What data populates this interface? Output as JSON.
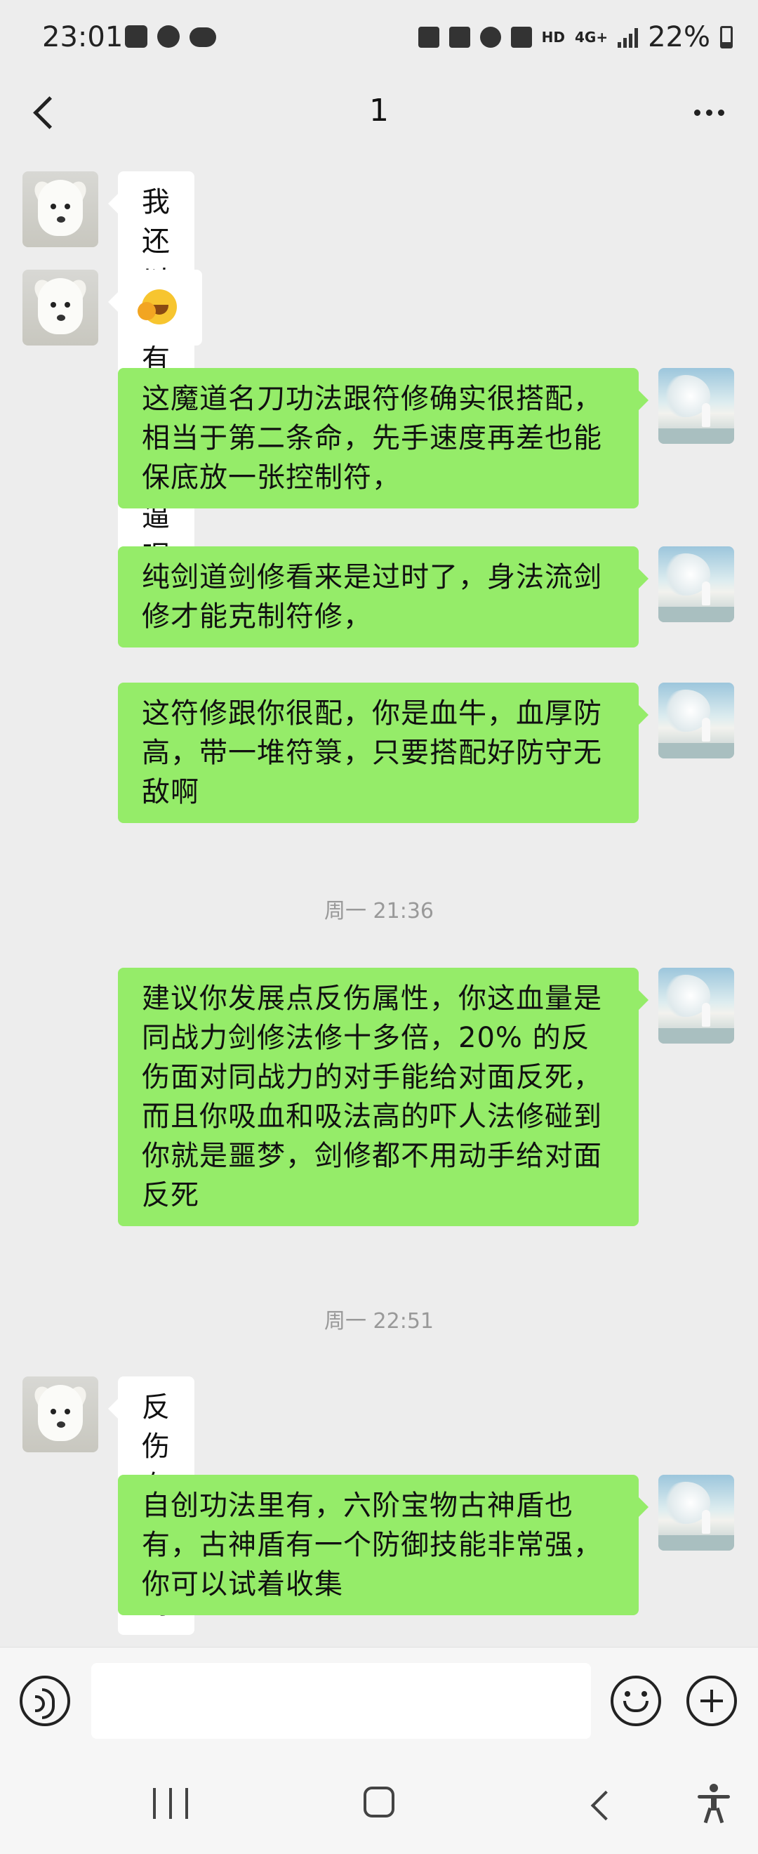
{
  "status_bar": {
    "time": "23:01",
    "network": "HD",
    "network_type": "4G+",
    "battery": "22%",
    "left_icons": [
      "gallery-icon",
      "globe-icon",
      "cloud-sync-icon"
    ],
    "right_icons": [
      "nfc-icon",
      "sleep-icon",
      "alarm-icon",
      "mute-icon",
      "hd-icon",
      "4g-icon",
      "signal-icon",
      "battery-icon"
    ]
  },
  "header": {
    "title": "1"
  },
  "messages": [
    {
      "side": "left",
      "avatar": "dog",
      "text": "我还以为有这么牛逼呢"
    },
    {
      "side": "left",
      "avatar": "dog",
      "emoji": "laugh-cry-emoji"
    },
    {
      "side": "right",
      "avatar": "art",
      "text": "这魔道名刀功法跟符修确实很搭配，相当于第二条命，先手速度再差也能保底放一张控制符，"
    },
    {
      "side": "right",
      "avatar": "art",
      "text": "纯剑道剑修看来是过时了，身法流剑修才能克制符修，"
    },
    {
      "side": "right",
      "avatar": "art",
      "text": "这符修跟你很配，你是血牛，血厚防高，带一堆符箓，只要搭配好防守无敌啊"
    },
    {
      "timestamp": "周一 21:36"
    },
    {
      "side": "right",
      "avatar": "art",
      "text": "建议你发展点反伤属性，你这血量是同战力剑修法修十多倍，20% 的反伤面对同战力的对手能给对面反死，而且你吸血和吸法高的吓人法修碰到你就是噩梦，剑修都不用动手给对面反死"
    },
    {
      "timestamp": "周一 22:51"
    },
    {
      "side": "left",
      "avatar": "dog",
      "text": "反伤有功法吗"
    },
    {
      "side": "right",
      "avatar": "art",
      "text": "自创功法里有，六阶宝物古神盾也有，古神盾有一个防御技能非常强，你可以试着收集"
    }
  ],
  "input": {
    "placeholder": "",
    "value": ""
  },
  "colors": {
    "background": "#ededed",
    "bubble_right": "#95ec69",
    "bubble_left": "#ffffff",
    "timestamp": "#999999"
  }
}
